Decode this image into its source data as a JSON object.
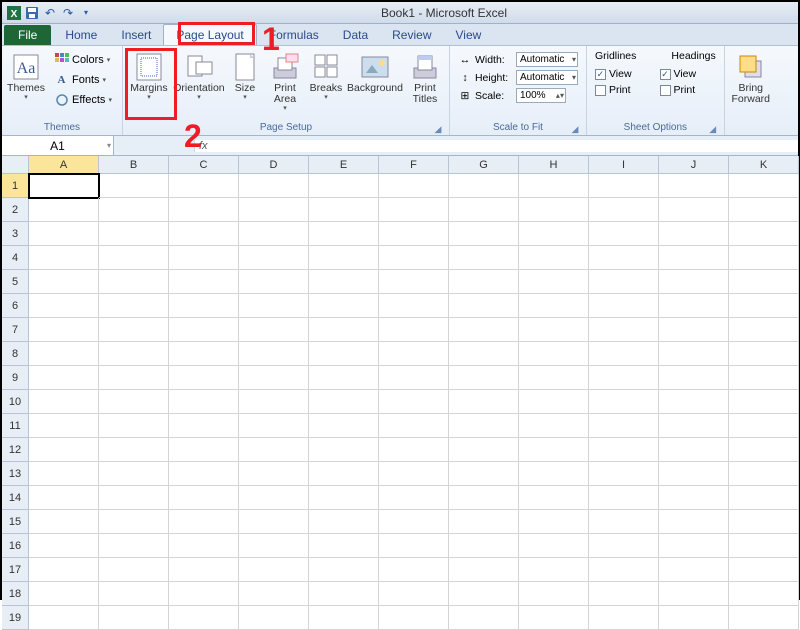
{
  "titlebar": {
    "title": "Book1 - Microsoft Excel"
  },
  "tabs": {
    "file": "File",
    "items": [
      "Home",
      "Insert",
      "Page Layout",
      "Formulas",
      "Data",
      "Review",
      "View"
    ],
    "active": "Page Layout"
  },
  "ribbon": {
    "themes": {
      "label": "Themes",
      "themes_btn": "Themes",
      "colors": "Colors",
      "fonts": "Fonts",
      "effects": "Effects"
    },
    "page_setup": {
      "label": "Page Setup",
      "margins": "Margins",
      "orientation": "Orientation",
      "size": "Size",
      "print_area": "Print\nArea",
      "breaks": "Breaks",
      "background": "Background",
      "print_titles": "Print\nTitles"
    },
    "scale": {
      "label": "Scale to Fit",
      "width": "Width:",
      "height": "Height:",
      "scale": "Scale:",
      "auto": "Automatic",
      "pct": "100%"
    },
    "sheet_options": {
      "label": "Sheet Options",
      "gridlines": "Gridlines",
      "headings": "Headings",
      "view": "View",
      "print": "Print"
    },
    "arrange": {
      "bring_forward": "Bring\nForward"
    }
  },
  "namebox": "A1",
  "fx_label": "fx",
  "columns": [
    "A",
    "B",
    "C",
    "D",
    "E",
    "F",
    "G",
    "H",
    "I",
    "J",
    "K"
  ],
  "rows": [
    1,
    2,
    3,
    4,
    5,
    6,
    7,
    8,
    9,
    10,
    11,
    12,
    13,
    14,
    15,
    16,
    17,
    18,
    19
  ],
  "active_cell": "A1",
  "annotations": {
    "one": "1",
    "two": "2"
  }
}
